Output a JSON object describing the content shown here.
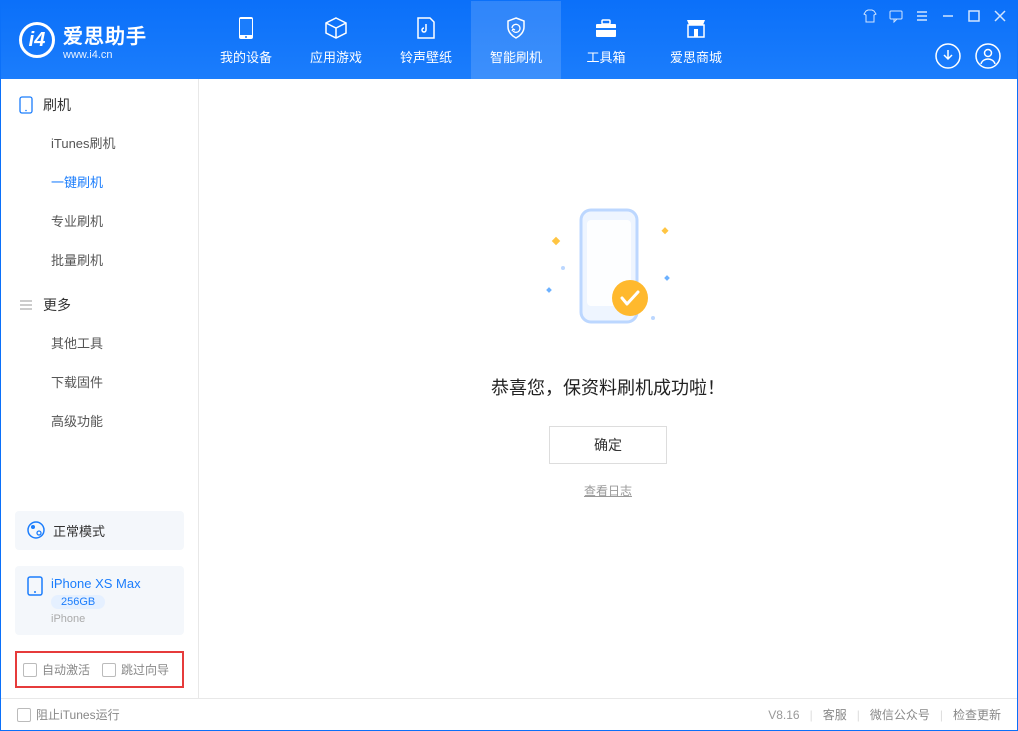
{
  "header": {
    "app_name": "爱思助手",
    "app_url": "www.i4.cn",
    "tabs": [
      {
        "label": "我的设备"
      },
      {
        "label": "应用游戏"
      },
      {
        "label": "铃声壁纸"
      },
      {
        "label": "智能刷机"
      },
      {
        "label": "工具箱"
      },
      {
        "label": "爱思商城"
      }
    ]
  },
  "sidebar": {
    "section1_title": "刷机",
    "section1_items": [
      "iTunes刷机",
      "一键刷机",
      "专业刷机",
      "批量刷机"
    ],
    "section2_title": "更多",
    "section2_items": [
      "其他工具",
      "下载固件",
      "高级功能"
    ],
    "mode_label": "正常模式",
    "device_name": "iPhone XS Max",
    "storage": "256GB",
    "device_sub": "iPhone",
    "opt_auto_activate": "自动激活",
    "opt_skip_guide": "跳过向导"
  },
  "main": {
    "success_text": "恭喜您，保资料刷机成功啦！",
    "ok_label": "确定",
    "view_log": "查看日志"
  },
  "statusbar": {
    "block_itunes": "阻止iTunes运行",
    "version": "V8.16",
    "support": "客服",
    "wechat": "微信公众号",
    "check_update": "检查更新"
  }
}
